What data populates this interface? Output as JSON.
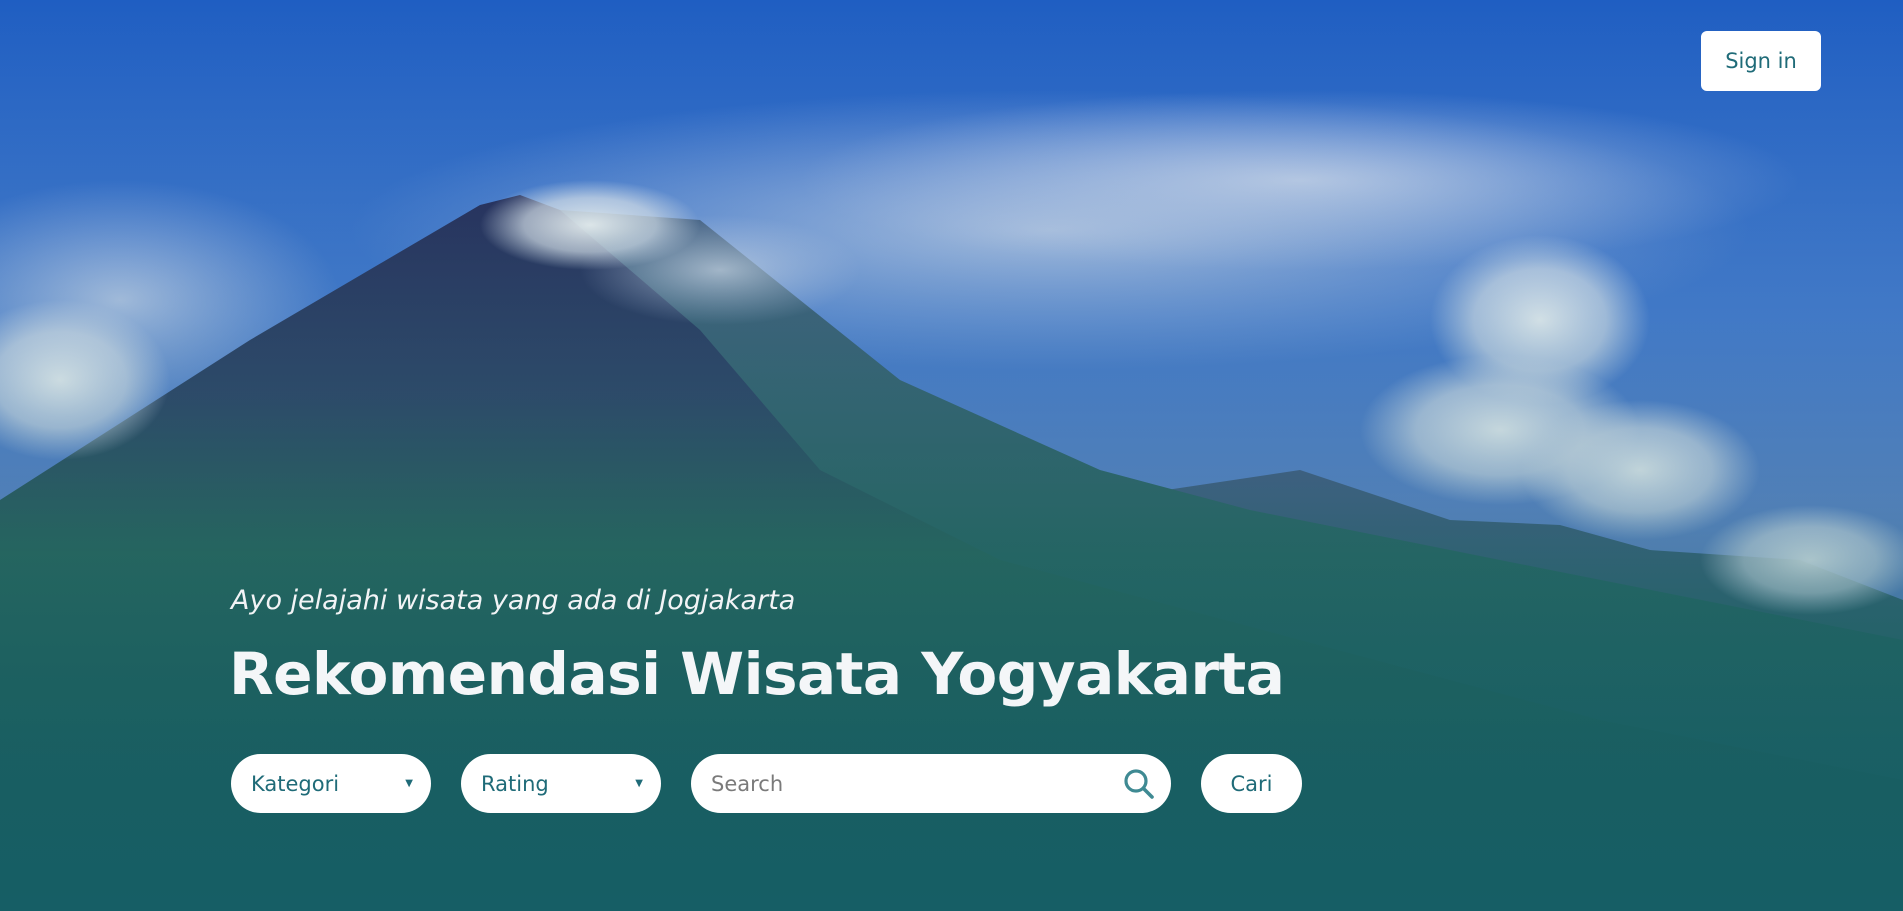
{
  "header": {
    "signin_label": "Sign in"
  },
  "hero": {
    "tagline": "Ayo jelajahi wisata yang ada di Jogjakarta",
    "title": "Rekomendasi Wisata Yogyakarta",
    "background": "volcano-landscape-photo"
  },
  "filters": {
    "category_label": "Kategori",
    "rating_label": "Rating",
    "search_placeholder": "Search",
    "search_icon": "search-icon",
    "submit_label": "Cari"
  },
  "colors": {
    "accent": "#1f6b78",
    "overlay": "#176160",
    "text_light": "#f4f6f8"
  }
}
